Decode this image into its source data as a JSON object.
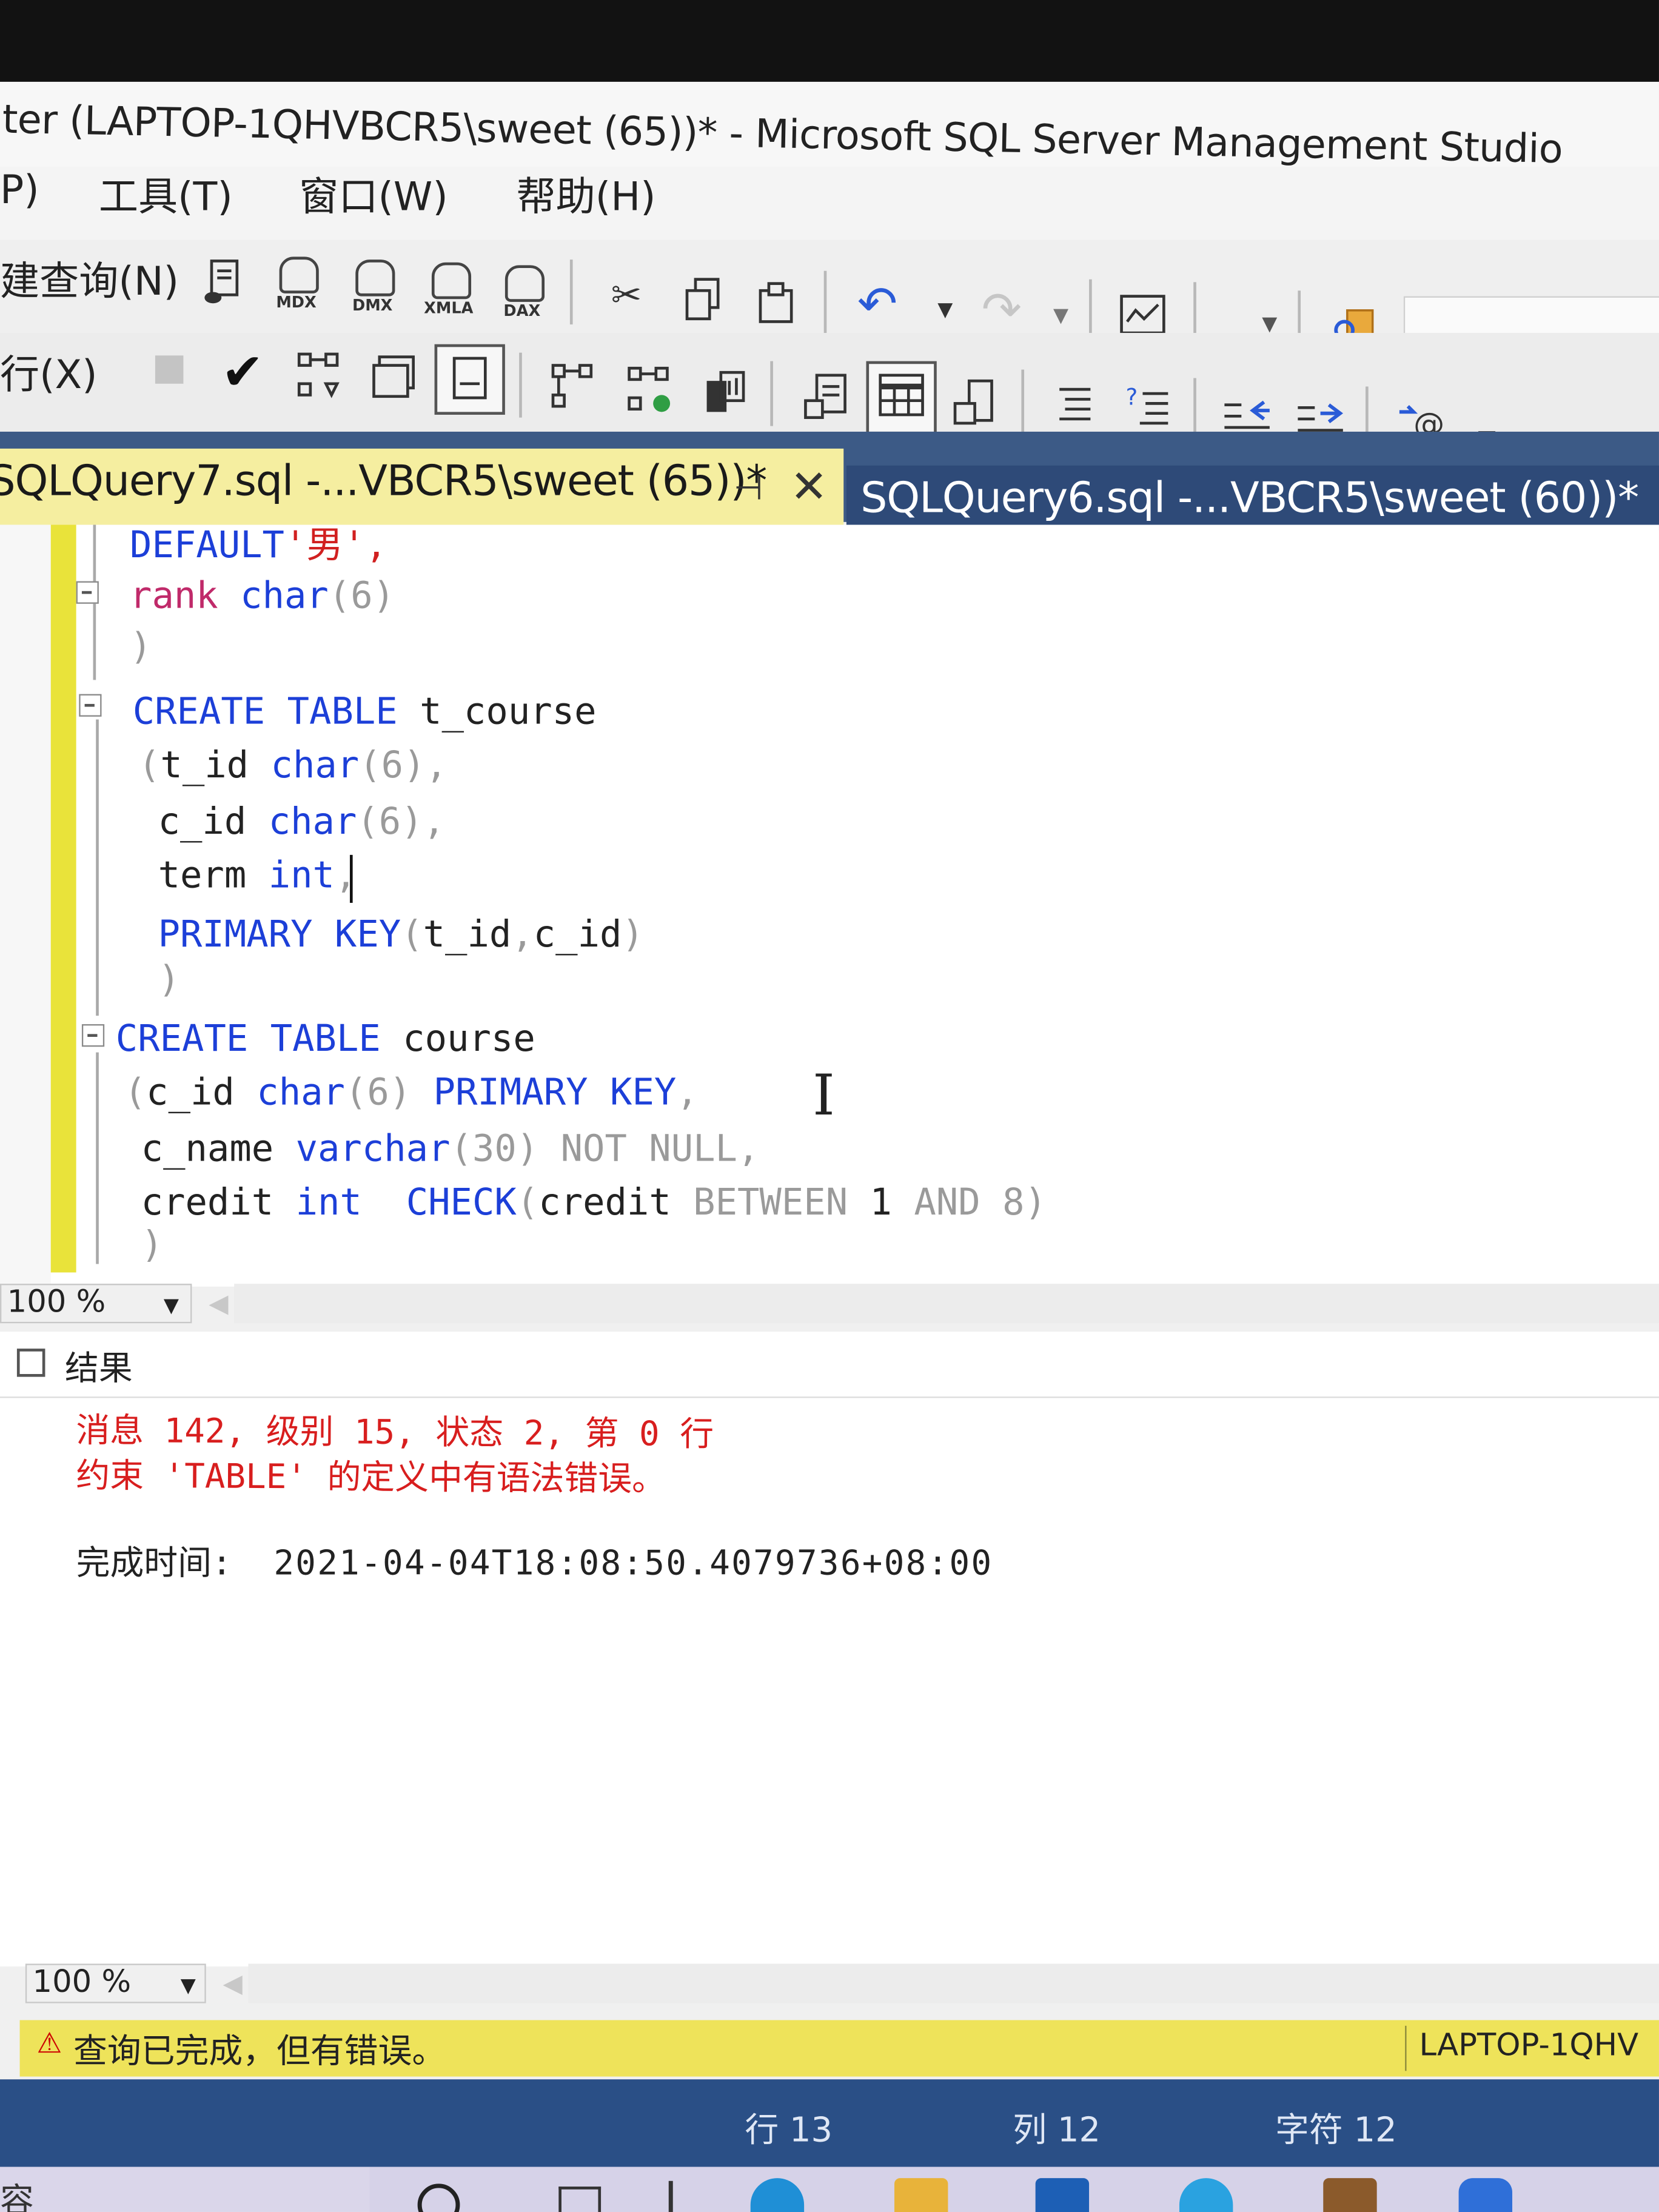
{
  "window": {
    "title": "ter (LAPTOP-1QHVBCR5\\sweet (65))* - Microsoft SQL Server Management Studio"
  },
  "menu": {
    "items": [
      "P)",
      "工具(T)",
      "窗口(W)",
      "帮助(H)"
    ]
  },
  "toolbar": {
    "new_query_label": "建查询(N)",
    "execute_label": "行(X)",
    "db_buttons": [
      "MDX",
      "DMX",
      "XMLA",
      "DAX"
    ]
  },
  "tabs": [
    {
      "label": "SQLQuery7.sql -...VBCR5\\sweet (65))*",
      "active": true
    },
    {
      "label": "SQLQuery6.sql -...VBCR5\\sweet (60))*",
      "active": false
    }
  ],
  "editor": {
    "lines": [
      {
        "segments": [
          {
            "t": "DEFAULT",
            "c": "kw"
          },
          {
            "t": "'男',",
            "c": "str"
          }
        ]
      },
      {
        "segments": [
          {
            "t": "rank",
            "c": "pnk"
          },
          {
            "t": " "
          },
          {
            "t": "char",
            "c": "typ"
          },
          {
            "t": "(6)",
            "c": "gry"
          }
        ]
      },
      {
        "segments": [
          {
            "t": ")",
            "c": "gry"
          }
        ]
      },
      {
        "segments": [
          {
            "t": "CREATE",
            "c": "kw"
          },
          {
            "t": " "
          },
          {
            "t": "TABLE",
            "c": "kw"
          },
          {
            "t": " t_course"
          }
        ]
      },
      {
        "segments": [
          {
            "t": "(",
            "c": "gry"
          },
          {
            "t": "t_id "
          },
          {
            "t": "char",
            "c": "typ"
          },
          {
            "t": "(6),",
            "c": "gry"
          }
        ]
      },
      {
        "segments": [
          {
            "t": "c_id "
          },
          {
            "t": "char",
            "c": "typ"
          },
          {
            "t": "(6),",
            "c": "gry"
          }
        ]
      },
      {
        "segments": [
          {
            "t": "term "
          },
          {
            "t": "int",
            "c": "typ"
          },
          {
            "t": ",",
            "c": "gry"
          }
        ]
      },
      {
        "segments": [
          {
            "t": "PRIMARY",
            "c": "kw"
          },
          {
            "t": " "
          },
          {
            "t": "KEY",
            "c": "kw"
          },
          {
            "t": "(",
            "c": "gry"
          },
          {
            "t": "t_id"
          },
          {
            "t": ",",
            "c": "gry"
          },
          {
            "t": "c_id"
          },
          {
            "t": ")",
            "c": "gry"
          }
        ]
      },
      {
        "segments": [
          {
            "t": ")",
            "c": "gry"
          }
        ]
      },
      {
        "segments": [
          {
            "t": "CREATE",
            "c": "kw"
          },
          {
            "t": " "
          },
          {
            "t": "TABLE",
            "c": "kw"
          },
          {
            "t": " course"
          }
        ]
      },
      {
        "segments": [
          {
            "t": "(",
            "c": "gry"
          },
          {
            "t": "c_id "
          },
          {
            "t": "char",
            "c": "typ"
          },
          {
            "t": "(6) ",
            "c": "gry"
          },
          {
            "t": "PRIMARY",
            "c": "kw"
          },
          {
            "t": " "
          },
          {
            "t": "KEY",
            "c": "kw"
          },
          {
            "t": ",",
            "c": "gry"
          }
        ]
      },
      {
        "segments": [
          {
            "t": "c_name "
          },
          {
            "t": "varchar",
            "c": "typ"
          },
          {
            "t": "(30) ",
            "c": "gry"
          },
          {
            "t": "NOT NULL,",
            "c": "gry"
          }
        ]
      },
      {
        "segments": [
          {
            "t": "credit "
          },
          {
            "t": "int",
            "c": "typ"
          },
          {
            "t": "  "
          },
          {
            "t": "CHECK",
            "c": "kw"
          },
          {
            "t": "(",
            "c": "gry"
          },
          {
            "t": "credit "
          },
          {
            "t": "BETWEEN",
            "c": "gry"
          },
          {
            "t": " 1 "
          },
          {
            "t": "AND",
            "c": "gry"
          },
          {
            "t": " 8)",
            "c": "gry"
          }
        ]
      },
      {
        "segments": [
          {
            "t": ")",
            "c": "gry"
          }
        ]
      }
    ]
  },
  "zoom": {
    "editor": "100 %",
    "results": "100 %"
  },
  "results": {
    "tab_label": "结果",
    "error_line1": "消息 142, 级别 15, 状态 2, 第 0 行",
    "error_line2": "约束 'TABLE' 的定义中有语法错误。",
    "completion_label": "完成时间:",
    "completion_time": "2021-04-04T18:08:50.4079736+08:00"
  },
  "status": {
    "message": "查询已完成，但有错误。",
    "server": "LAPTOP-1QHV",
    "line": "行 13",
    "column": "列 12",
    "char": "字符 12"
  },
  "taskbar": {
    "start_text": "容"
  }
}
